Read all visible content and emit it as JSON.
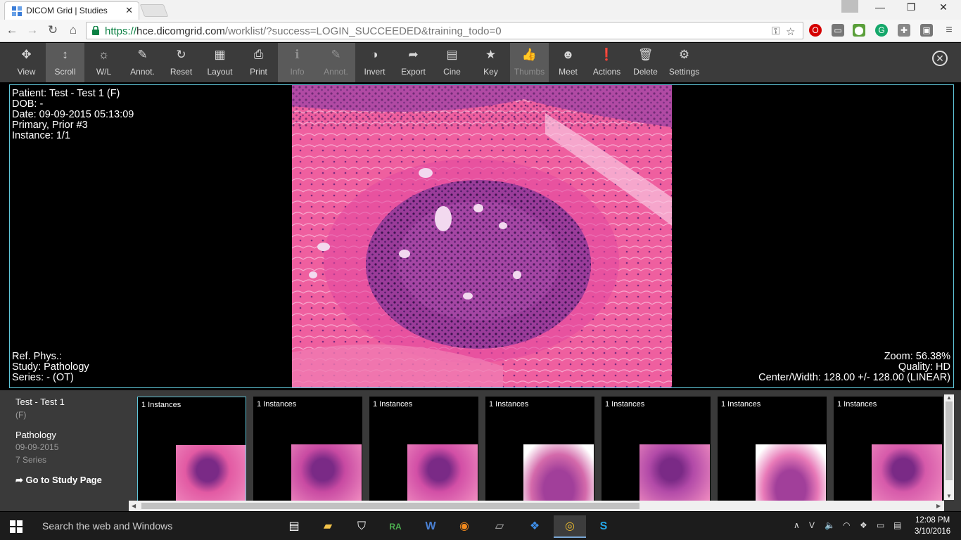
{
  "browser": {
    "tab_title": "DICOM Grid | Studies",
    "tab_close": "✕",
    "url_scheme": "https://",
    "url_host": "hce.dicomgrid.com",
    "url_rest": "/worklist/?success=LOGIN_SUCCEEDED&training_todo=0",
    "nav": {
      "back": "←",
      "forward": "→",
      "reload": "↻",
      "home": "⌂"
    }
  },
  "toolbar": {
    "tools": [
      {
        "id": "view",
        "label": "View",
        "icon": "✥",
        "state": "normal"
      },
      {
        "id": "scroll",
        "label": "Scroll",
        "icon": "↕",
        "state": "active"
      },
      {
        "id": "wl",
        "label": "W/L",
        "icon": "☼",
        "state": "normal"
      },
      {
        "id": "annot",
        "label": "Annot.",
        "icon": "✎",
        "state": "normal"
      },
      {
        "id": "reset",
        "label": "Reset",
        "icon": "↻",
        "state": "normal"
      },
      {
        "id": "layout",
        "label": "Layout",
        "icon": "▦",
        "state": "normal"
      },
      {
        "id": "print",
        "label": "Print",
        "icon": "⎙",
        "state": "normal"
      },
      {
        "id": "info",
        "label": "Info",
        "icon": "ℹ",
        "state": "disabled"
      },
      {
        "id": "annot2",
        "label": "Annot.",
        "icon": "✎",
        "state": "disabled"
      },
      {
        "id": "invert",
        "label": "Invert",
        "icon": "◑",
        "state": "normal"
      },
      {
        "id": "export",
        "label": "Export",
        "icon": "➦",
        "state": "normal"
      },
      {
        "id": "cine",
        "label": "Cine",
        "icon": "▤",
        "state": "normal"
      },
      {
        "id": "key",
        "label": "Key",
        "icon": "★",
        "state": "normal"
      },
      {
        "id": "thumbs",
        "label": "Thumbs",
        "icon": "👍",
        "state": "disabled"
      },
      {
        "id": "meet",
        "label": "Meet",
        "icon": "☻",
        "state": "normal"
      },
      {
        "id": "actions",
        "label": "Actions",
        "icon": "❗",
        "state": "normal"
      },
      {
        "id": "delete",
        "label": "Delete",
        "icon": "🗑",
        "state": "normal"
      },
      {
        "id": "settings",
        "label": "Settings",
        "icon": "⚙",
        "state": "normal"
      }
    ],
    "close": "✕"
  },
  "viewer": {
    "top_left": [
      "Patient: Test - Test 1 (F)",
      "DOB: -",
      "Date: 09-09-2015 05:13:09",
      "Primary, Prior #3",
      "Instance: 1/1"
    ],
    "bottom_left": [
      "Ref. Phys.:",
      "Study: Pathology",
      "Series: - (OT)"
    ],
    "bottom_right": [
      "Zoom: 56.38%",
      "Quality: HD",
      "Center/Width: 128.00 +/- 128.00 (LINEAR)"
    ]
  },
  "study_panel": {
    "patient_name": "Test - Test 1",
    "sex": "(F)",
    "study": "Pathology",
    "date": "09-09-2015",
    "series": "7 Series",
    "goto_label": "Go to Study Page"
  },
  "thumbnails": [
    {
      "label": "1 Instances",
      "selected": true
    },
    {
      "label": "1 Instances",
      "selected": false
    },
    {
      "label": "1 Instances",
      "selected": false
    },
    {
      "label": "1 Instances",
      "selected": false
    },
    {
      "label": "1 Instances",
      "selected": false
    },
    {
      "label": "1 Instances",
      "selected": false
    },
    {
      "label": "1 Instances",
      "selected": false
    }
  ],
  "taskbar": {
    "search_placeholder": "Search the web and Windows",
    "time": "12:08 PM",
    "date": "3/10/2016"
  }
}
